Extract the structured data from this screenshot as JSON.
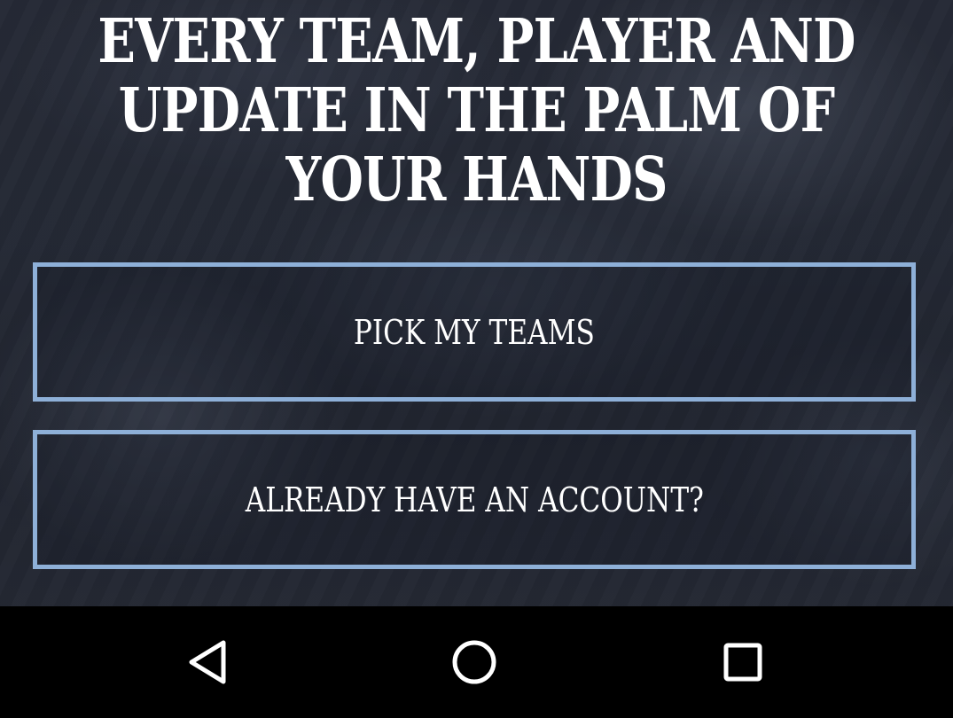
{
  "hero": {
    "headline_lines": [
      "EVERY TEAM, PLAYER AND",
      "UPDATE IN THE PALM OF",
      "YOUR HANDS"
    ]
  },
  "buttons": {
    "pick_teams": "PICK MY TEAMS",
    "have_account": "ALREADY HAVE AN ACCOUNT?"
  },
  "navbar": {
    "icons": [
      "back-triangle",
      "home-circle",
      "recents-square"
    ]
  },
  "colors": {
    "button_border": "#8eb0d8",
    "text": "#ffffff",
    "navbar_bg": "#000000"
  }
}
